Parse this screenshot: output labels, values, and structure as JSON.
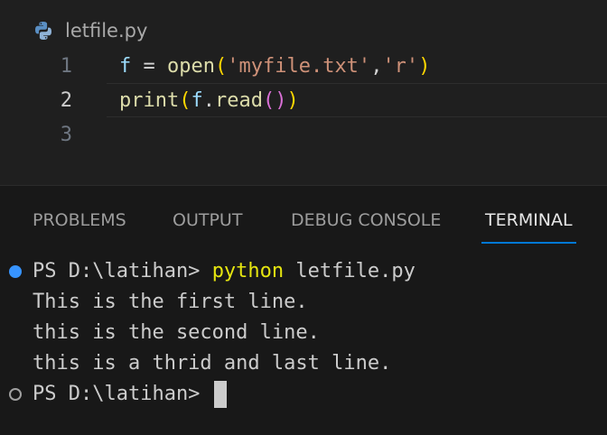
{
  "editor": {
    "filename": "letfile.py",
    "lines": [
      {
        "number": "1",
        "tokens": [
          {
            "t": "f",
            "c": "var"
          },
          {
            "t": " = ",
            "c": "op"
          },
          {
            "t": "open",
            "c": "fn"
          },
          {
            "t": "(",
            "c": "par1"
          },
          {
            "t": "'myfile.txt'",
            "c": "str"
          },
          {
            "t": ",",
            "c": "plain"
          },
          {
            "t": "'r'",
            "c": "str"
          },
          {
            "t": ")",
            "c": "par1"
          }
        ]
      },
      {
        "number": "2",
        "tokens": [
          {
            "t": "print",
            "c": "fn"
          },
          {
            "t": "(",
            "c": "par1"
          },
          {
            "t": "f",
            "c": "var"
          },
          {
            "t": ".",
            "c": "plain"
          },
          {
            "t": "read",
            "c": "fn"
          },
          {
            "t": "()",
            "c": "par2"
          },
          {
            "t": ")",
            "c": "par1"
          }
        ]
      },
      {
        "number": "3",
        "tokens": []
      }
    ]
  },
  "panel": {
    "tabs": [
      {
        "label": "PROBLEMS",
        "active": false
      },
      {
        "label": "OUTPUT",
        "active": false
      },
      {
        "label": "DEBUG CONSOLE",
        "active": false
      },
      {
        "label": "TERMINAL",
        "active": true
      }
    ]
  },
  "terminal": {
    "prompt1": "PS D:\\latihan> ",
    "command": "python",
    "args": " letfile.py",
    "output": [
      "This is the first line.",
      "this is the second line.",
      "this is a thrid and last line."
    ],
    "prompt2": "PS D:\\latihan> "
  },
  "colors": {
    "accent": "#0078d4",
    "status_dot": "#3794ff",
    "command": "#e5e510"
  },
  "icons": {
    "file": "python-icon",
    "status_success": "circle-filled-icon",
    "status_idle": "circle-hollow-icon"
  }
}
